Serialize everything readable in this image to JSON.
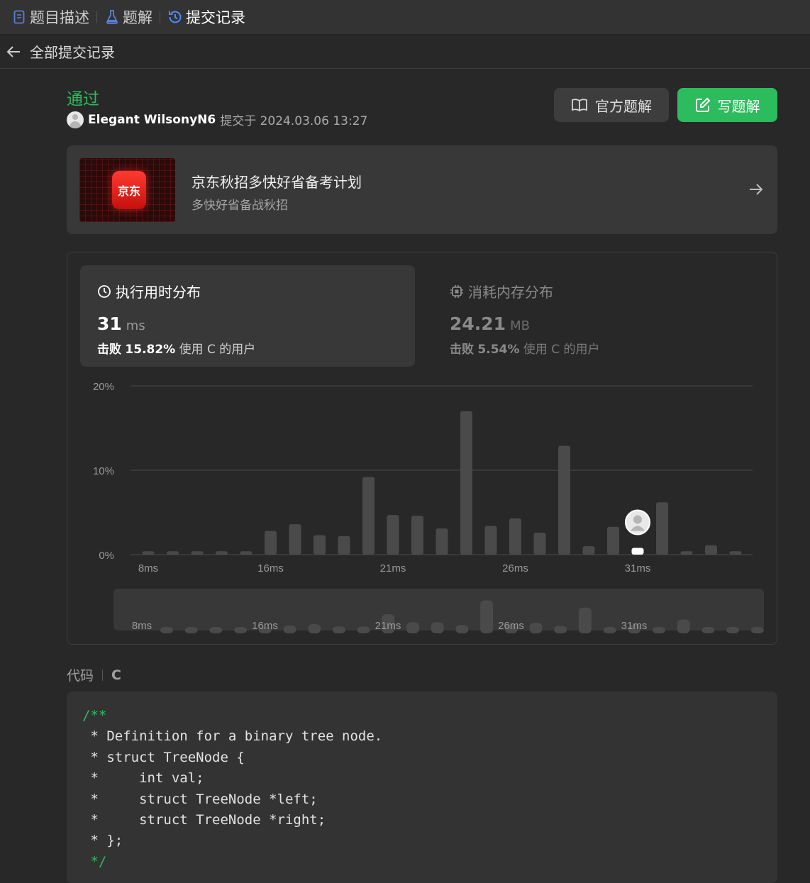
{
  "tabs": [
    {
      "label": "题目描述",
      "icon": "document-icon"
    },
    {
      "label": "题解",
      "icon": "flask-icon"
    },
    {
      "label": "提交记录",
      "icon": "history-icon"
    }
  ],
  "subbar": {
    "back_label": "全部提交记录"
  },
  "submission": {
    "status": "通过",
    "username": "Elegant WilsonyN6",
    "submitted_text": "提交于 2024.03.06 13:27"
  },
  "buttons": {
    "official_solution": "官方题解",
    "write_solution": "写题解"
  },
  "promo": {
    "logo_text": "京东",
    "title": "京东秋招多快好省备考计划",
    "subtitle": "多快好省备战秋招"
  },
  "runtime": {
    "title": "执行用时分布",
    "value": "31",
    "unit": "ms",
    "beat_prefix": "击败",
    "beat_percent": "15.82%",
    "beat_suffix": "使用 C 的用户"
  },
  "memory": {
    "title": "消耗内存分布",
    "value": "24.21",
    "unit": "MB",
    "beat_prefix": "击败",
    "beat_percent": "5.54%",
    "beat_suffix": "使用 C 的用户"
  },
  "chart_data": {
    "type": "bar",
    "ylim": [
      0,
      20
    ],
    "ytick_labels": [
      "20%",
      "10%",
      "0%"
    ],
    "xtick_labels": [
      "8ms",
      "16ms",
      "21ms",
      "26ms",
      "31ms"
    ],
    "highlight_index": 20,
    "values": [
      0.4,
      0.4,
      0.4,
      0.4,
      0.4,
      2.8,
      3.6,
      2.3,
      2.2,
      9.2,
      4.7,
      4.6,
      3.1,
      17.0,
      3.4,
      4.3,
      2.6,
      12.9,
      1.0,
      3.3,
      0.8,
      6.2,
      0.4,
      1.1,
      0.4
    ],
    "grid": true
  },
  "colors": {
    "accent": "#2cbb5d",
    "bar": "#4a4a4a",
    "highlight": "#ffffff"
  },
  "code_section": {
    "label": "代码",
    "language": "C"
  },
  "code": {
    "lines": [
      "/**",
      " * Definition for a binary tree node.",
      " * struct TreeNode {",
      " *     int val;",
      " *     struct TreeNode *left;",
      " *     struct TreeNode *right;",
      " * };",
      " */"
    ]
  }
}
